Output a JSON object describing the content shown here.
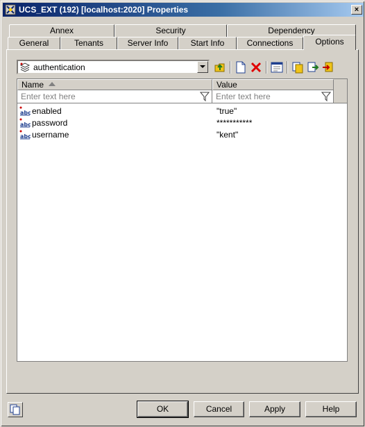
{
  "window": {
    "title": "UCS_EXT (192) [localhost:2020] Properties",
    "close_glyph": "×"
  },
  "tabs": {
    "row_back": [
      "Annex",
      "Security",
      "Dependency"
    ],
    "row_front": [
      "General",
      "Tenants",
      "Server Info",
      "Start Info",
      "Connections",
      "Options"
    ],
    "active": "Options"
  },
  "section_combo": {
    "value": "authentication",
    "icon": "stack-layers-icon"
  },
  "toolbar": {
    "icons": [
      "folder-up-icon",
      "new-document-icon",
      "delete-icon",
      "edit-properties-icon",
      "copy-option-icon",
      "export-option-icon",
      "import-option-icon"
    ]
  },
  "grid": {
    "columns": [
      "Name",
      "Value"
    ],
    "filter_placeholders": [
      "Enter text here",
      "Enter text here"
    ],
    "rows": [
      {
        "name": "enabled",
        "value": "\"true\""
      },
      {
        "name": "password",
        "value": "***********"
      },
      {
        "name": "username",
        "value": "\"kent\""
      }
    ]
  },
  "buttons": {
    "ok": "OK",
    "cancel": "Cancel",
    "apply": "Apply",
    "help": "Help"
  },
  "colors": {
    "title_start": "#0a246a",
    "title_end": "#a6caf0",
    "dialog_bg": "#d4d0c8"
  }
}
